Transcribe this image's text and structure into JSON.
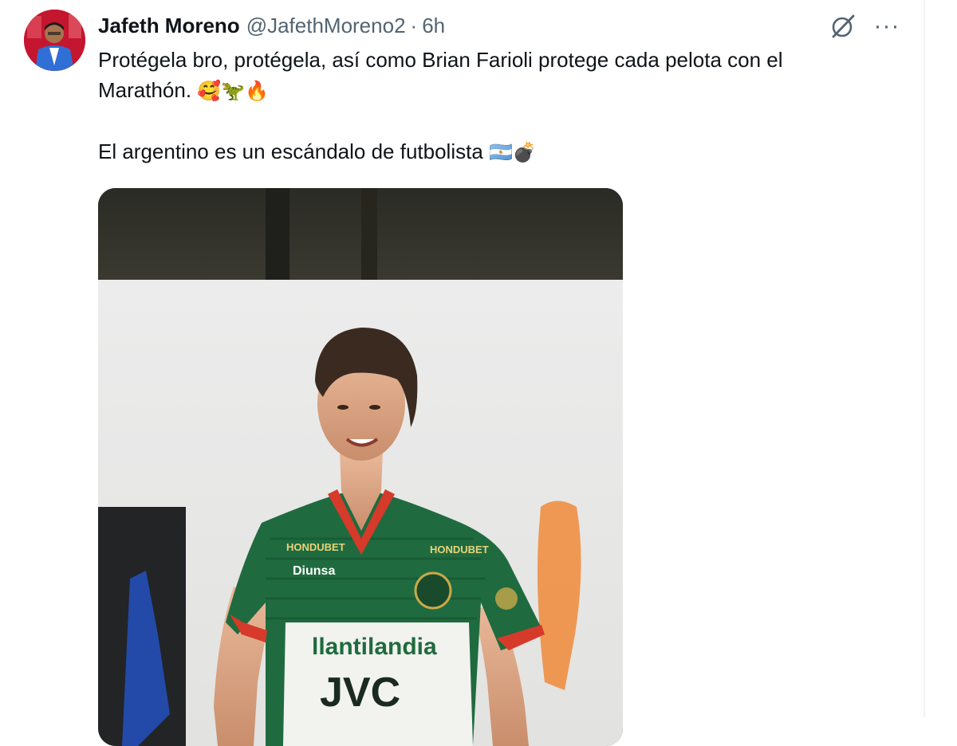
{
  "tweet": {
    "author_name": "Jafeth Moreno",
    "handle": "@JafethMoreno2",
    "separator": "·",
    "time": "6h",
    "more_label": "···",
    "line1": "Protégela bro, protégela, así como Brian Farioli protege cada pelota con el",
    "line2_text": "Marathón.",
    "line2_emojis": "🥰🦖🔥",
    "line3_text": "El argentino es un escándalo de futbolista",
    "line3_emojis": "🇦🇷💣"
  },
  "media": {
    "jersey_sponsor_1": "llantilandia",
    "jersey_sponsor_2": "JVC",
    "jersey_chest_left": "HONDUBET",
    "jersey_chest_right": "HONDUBET",
    "jersey_sponsor_small": "Diunsa"
  },
  "colors": {
    "name": "#0f1419",
    "secondary_text": "#536471",
    "jersey_green": "#1f6b3f",
    "jersey_white": "#f2f2ee",
    "collar_red": "#d63a2a"
  },
  "icons": {
    "grok": "grok-icon",
    "more": "more-icon"
  }
}
